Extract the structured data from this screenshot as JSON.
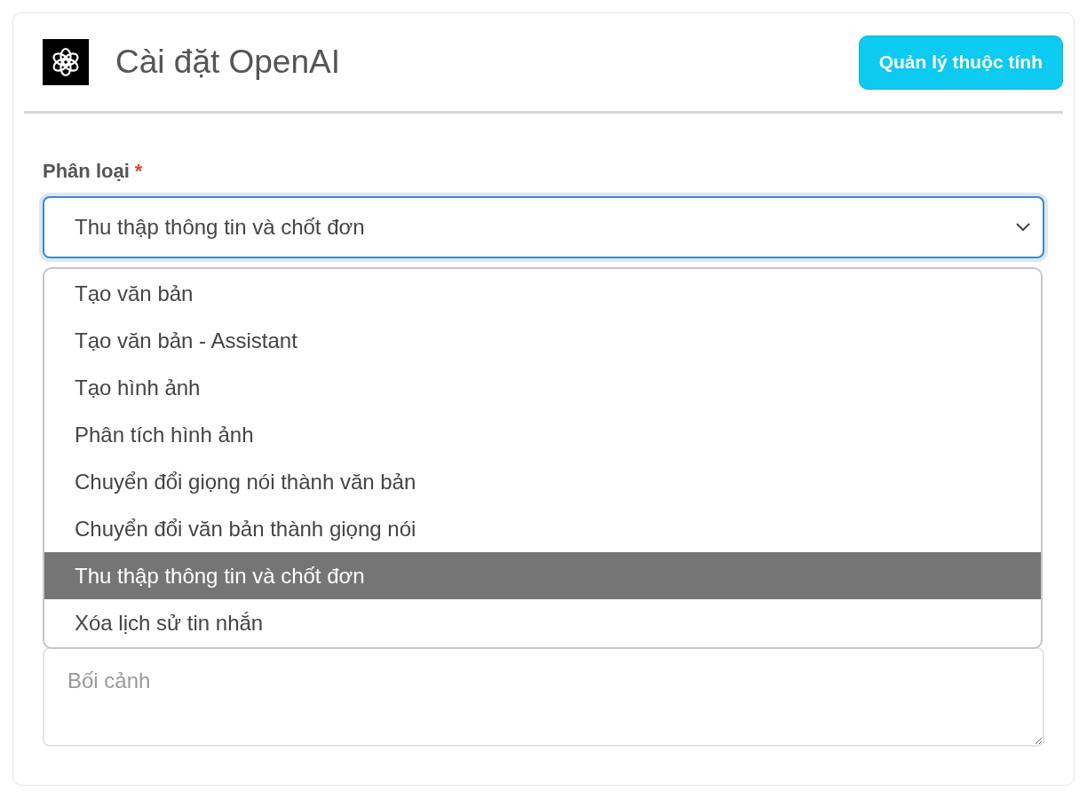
{
  "header": {
    "title": "Cài đặt OpenAI",
    "button": "Quản lý thuộc tính"
  },
  "category_field": {
    "label": "Phân loại",
    "required": true,
    "required_mark": "*",
    "value": "Thu thập thông tin và chốt đơn",
    "expanded": true,
    "options": [
      {
        "label": "Tạo văn bản",
        "selected": false
      },
      {
        "label": "Tạo văn bản - Assistant",
        "selected": false
      },
      {
        "label": "Tạo hình ảnh",
        "selected": false
      },
      {
        "label": "Phân tích hình ảnh",
        "selected": false
      },
      {
        "label": "Chuyển đổi giọng nói thành văn bản",
        "selected": false
      },
      {
        "label": "Chuyển đổi văn bản thành giọng nói",
        "selected": false
      },
      {
        "label": "Thu thập thông tin và chốt đơn",
        "selected": true
      },
      {
        "label": "Xóa lịch sử tin nhắn",
        "selected": false
      }
    ]
  },
  "context_field": {
    "placeholder": "Bối cảnh"
  }
}
